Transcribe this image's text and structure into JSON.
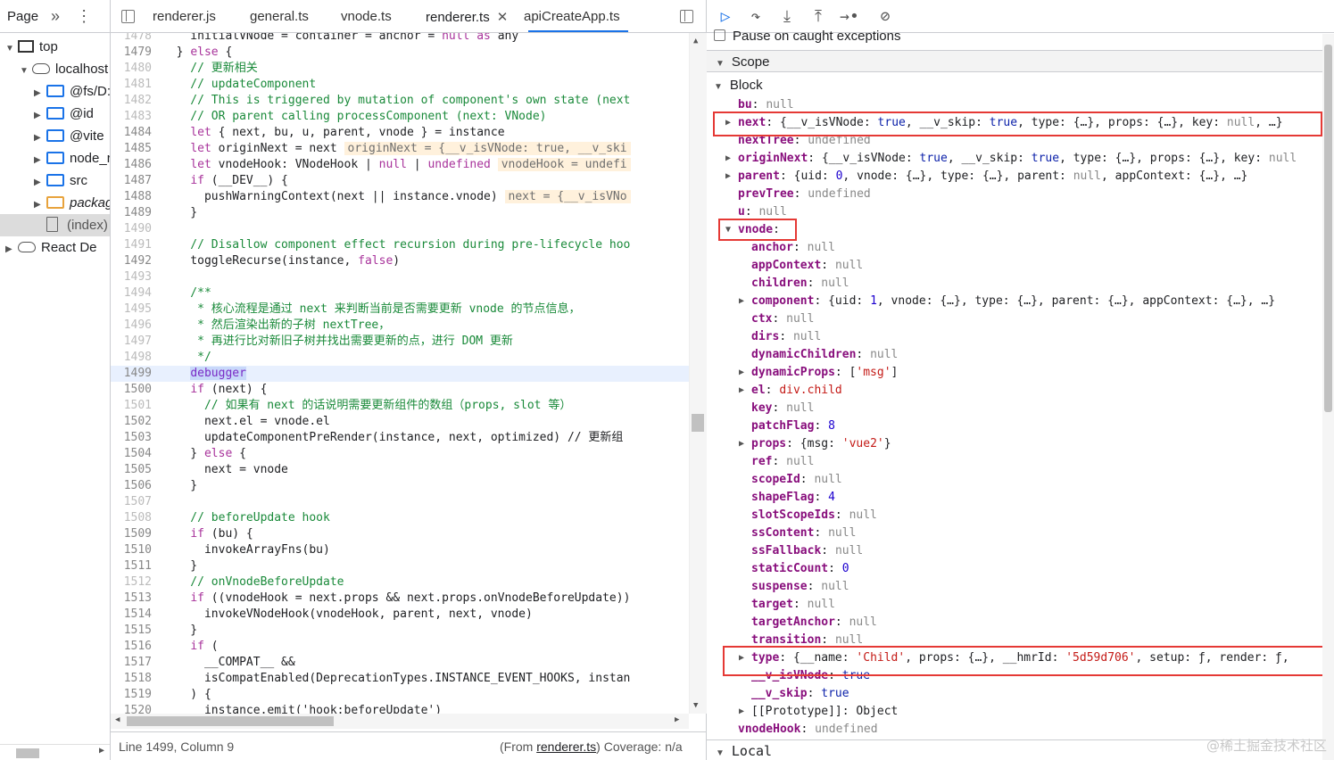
{
  "navigator": {
    "tab_label": "Page",
    "tree": [
      {
        "label": "top",
        "indent": 0,
        "type": "window",
        "expanded": true
      },
      {
        "label": "localhost",
        "indent": 1,
        "type": "cloud",
        "expanded": true
      },
      {
        "label": "@fs/D:",
        "indent": 2,
        "type": "folder",
        "expanded": false
      },
      {
        "label": "@id",
        "indent": 2,
        "type": "folder",
        "expanded": false
      },
      {
        "label": "@vite",
        "indent": 2,
        "type": "folder",
        "expanded": false
      },
      {
        "label": "node_r",
        "indent": 2,
        "type": "folder",
        "expanded": false
      },
      {
        "label": "src",
        "indent": 2,
        "type": "folder",
        "expanded": false
      },
      {
        "label": "packag",
        "indent": 2,
        "type": "folder-orange",
        "expanded": false
      },
      {
        "label": "(index)",
        "indent": 2,
        "type": "file",
        "selected": true
      },
      {
        "label": "React De",
        "indent": 0,
        "type": "cloud",
        "expanded": false
      }
    ]
  },
  "editor": {
    "tabs": [
      "renderer.js",
      "general.ts",
      "vnode.ts",
      "renderer.ts",
      "apiCreateApp.ts"
    ],
    "active_tab": "renderer.ts",
    "lines": [
      {
        "n": "1478",
        "t": "    initialVNode = container = anchor = null as any",
        "dim": true
      },
      {
        "n": "1479",
        "t": "  } else {"
      },
      {
        "n": "1480",
        "t": "    // 更新相关",
        "dim": true,
        "c": true
      },
      {
        "n": "1481",
        "t": "    // updateComponent",
        "dim": true,
        "c": true
      },
      {
        "n": "1482",
        "t": "    // This is triggered by mutation of component's own state (next",
        "dim": true,
        "c": true
      },
      {
        "n": "1483",
        "t": "    // OR parent calling processComponent (next: VNode)",
        "dim": true,
        "c": true
      },
      {
        "n": "1484",
        "t": "    let { next, bu, u, parent, vnode } = instance"
      },
      {
        "n": "1485",
        "t": "    let originNext = next ",
        "v": "originNext = {__v_isVNode: true, __v_ski"
      },
      {
        "n": "1486",
        "t": "    let vnodeHook: VNodeHook | null | undefined ",
        "v": "vnodeHook = undefi"
      },
      {
        "n": "1487",
        "t": "    if (__DEV__) {"
      },
      {
        "n": "1488",
        "t": "      pushWarningContext(next || instance.vnode) ",
        "v": "next = {__v_isVNo"
      },
      {
        "n": "1489",
        "t": "    }"
      },
      {
        "n": "1490",
        "t": "",
        "dim": true
      },
      {
        "n": "1491",
        "t": "    // Disallow component effect recursion during pre-lifecycle hoo",
        "dim": true,
        "c": true
      },
      {
        "n": "1492",
        "t": "    toggleRecurse(instance, false)"
      },
      {
        "n": "1493",
        "t": "",
        "dim": true
      },
      {
        "n": "1494",
        "t": "    /**",
        "dim": true,
        "c": true
      },
      {
        "n": "1495",
        "t": "     * 核心流程是通过 next 来判断当前是否需要更新 vnode 的节点信息，",
        "dim": true,
        "c": true
      },
      {
        "n": "1496",
        "t": "     * 然后渲染出新的子树 nextTree，",
        "dim": true,
        "c": true
      },
      {
        "n": "1497",
        "t": "     * 再进行比对新旧子树并找出需要更新的点，进行 DOM 更新",
        "dim": true,
        "c": true
      },
      {
        "n": "1498",
        "t": "     */",
        "dim": true,
        "c": true
      },
      {
        "n": "1499",
        "t": "    ",
        "d": "debugger",
        "hl": true
      },
      {
        "n": "1500",
        "t": "    if (next) {"
      },
      {
        "n": "1501",
        "t": "      // 如果有 next 的话说明需要更新组件的数组（props, slot 等）",
        "dim": true,
        "c": true
      },
      {
        "n": "1502",
        "t": "      next.el = vnode.el"
      },
      {
        "n": "1503",
        "t": "      updateComponentPreRender(instance, next, optimized) // 更新组"
      },
      {
        "n": "1504",
        "t": "    } else {"
      },
      {
        "n": "1505",
        "t": "      next = vnode"
      },
      {
        "n": "1506",
        "t": "    }"
      },
      {
        "n": "1507",
        "t": "",
        "dim": true
      },
      {
        "n": "1508",
        "t": "    // beforeUpdate hook",
        "dim": true,
        "c": true
      },
      {
        "n": "1509",
        "t": "    if (bu) {"
      },
      {
        "n": "1510",
        "t": "      invokeArrayFns(bu)"
      },
      {
        "n": "1511",
        "t": "    }"
      },
      {
        "n": "1512",
        "t": "    // onVnodeBeforeUpdate",
        "dim": true,
        "c": true
      },
      {
        "n": "1513",
        "t": "    if ((vnodeHook = next.props && next.props.onVnodeBeforeUpdate))"
      },
      {
        "n": "1514",
        "t": "      invokeVNodeHook(vnodeHook, parent, next, vnode)"
      },
      {
        "n": "1515",
        "t": "    }"
      },
      {
        "n": "1516",
        "t": "    if ("
      },
      {
        "n": "1517",
        "t": "      __COMPAT__ &&"
      },
      {
        "n": "1518",
        "t": "      isCompatEnabled(DeprecationTypes.INSTANCE_EVENT_HOOKS, instan"
      },
      {
        "n": "1519",
        "t": "    ) {"
      },
      {
        "n": "1520",
        "t": "      instance.emit('hook:beforeUpdate')"
      }
    ],
    "status_position": "Line 1499, Column 9",
    "status_from_prefix": "(From ",
    "status_from_file": "renderer.ts",
    "status_coverage": ") Coverage: n/a"
  },
  "debugger": {
    "pause_label": "Pause on caught exceptions",
    "scope_label": "Scope",
    "local_label": "Local",
    "block_label": "Block",
    "props": [
      {
        "i": 1,
        "k": "bu",
        "v": "null",
        "vt": "n"
      },
      {
        "i": 1,
        "k": "next",
        "v": "{__v_isVNode: true, __v_skip: true, type: {…}, props: {…}, key: null, …}",
        "tri": true
      },
      {
        "i": 1,
        "k": "nextTree",
        "v": "undefined",
        "vt": "n"
      },
      {
        "i": 1,
        "k": "originNext",
        "v": "{__v_isVNode: true, __v_skip: true, type: {…}, props: {…}, key: null",
        "tri": true
      },
      {
        "i": 1,
        "k": "parent",
        "v": "{uid: 0, vnode: {…}, type: {…}, parent: null, appContext: {…}, …}",
        "tri": true
      },
      {
        "i": 1,
        "k": "prevTree",
        "v": "undefined",
        "vt": "n"
      },
      {
        "i": 1,
        "k": "u",
        "v": "null",
        "vt": "n"
      },
      {
        "i": 1,
        "k": "vnode",
        "v": "",
        "tri": "open"
      },
      {
        "i": 2,
        "k": "anchor",
        "v": "null",
        "vt": "n"
      },
      {
        "i": 2,
        "k": "appContext",
        "v": "null",
        "vt": "n"
      },
      {
        "i": 2,
        "k": "children",
        "v": "null",
        "vt": "n"
      },
      {
        "i": 2,
        "k": "component",
        "v": "{uid: 1, vnode: {…}, type: {…}, parent: {…}, appContext: {…}, …}",
        "tri": true
      },
      {
        "i": 2,
        "k": "ctx",
        "v": "null",
        "vt": "n"
      },
      {
        "i": 2,
        "k": "dirs",
        "v": "null",
        "vt": "n"
      },
      {
        "i": 2,
        "k": "dynamicChildren",
        "v": "null",
        "vt": "n"
      },
      {
        "i": 2,
        "k": "dynamicProps",
        "v": "['msg']",
        "tri": true
      },
      {
        "i": 2,
        "k": "el",
        "v": "div.child",
        "vt": "s",
        "tri": true
      },
      {
        "i": 2,
        "k": "key",
        "v": "null",
        "vt": "n"
      },
      {
        "i": 2,
        "k": "patchFlag",
        "v": "8",
        "vt": "num"
      },
      {
        "i": 2,
        "k": "props",
        "v": "{msg: 'vue2'}",
        "tri": true
      },
      {
        "i": 2,
        "k": "ref",
        "v": "null",
        "vt": "n"
      },
      {
        "i": 2,
        "k": "scopeId",
        "v": "null",
        "vt": "n"
      },
      {
        "i": 2,
        "k": "shapeFlag",
        "v": "4",
        "vt": "num"
      },
      {
        "i": 2,
        "k": "slotScopeIds",
        "v": "null",
        "vt": "n"
      },
      {
        "i": 2,
        "k": "ssContent",
        "v": "null",
        "vt": "n"
      },
      {
        "i": 2,
        "k": "ssFallback",
        "v": "null",
        "vt": "n"
      },
      {
        "i": 2,
        "k": "staticCount",
        "v": "0",
        "vt": "num"
      },
      {
        "i": 2,
        "k": "suspense",
        "v": "null",
        "vt": "n"
      },
      {
        "i": 2,
        "k": "target",
        "v": "null",
        "vt": "n"
      },
      {
        "i": 2,
        "k": "targetAnchor",
        "v": "null",
        "vt": "n"
      },
      {
        "i": 2,
        "k": "transition",
        "v": "null",
        "vt": "n"
      },
      {
        "i": 2,
        "k": "type",
        "v": "{__name: 'Child', props: {…}, __hmrId: '5d59d706', setup: ƒ, render: ƒ,",
        "tri": true
      },
      {
        "i": 2,
        "k": "__v_isVNode",
        "v": "true",
        "vt": "bool"
      },
      {
        "i": 2,
        "k": "__v_skip",
        "v": "true",
        "vt": "bool"
      },
      {
        "i": 2,
        "k": "[[Prototype]]",
        "v": "Object",
        "tri": true,
        "plain": true
      },
      {
        "i": 1,
        "k": "vnodeHook",
        "v": "undefined",
        "vt": "n"
      }
    ]
  },
  "watermark": "@稀土掘金技术社区"
}
